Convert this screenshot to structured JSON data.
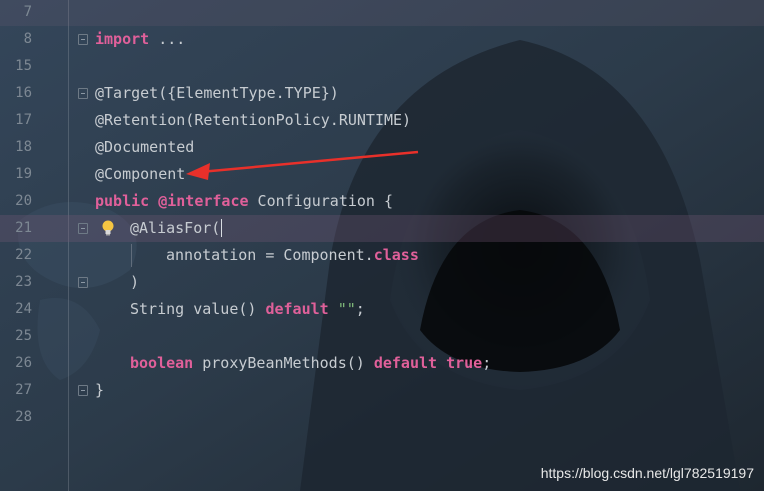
{
  "editor": {
    "lines": [
      {
        "num": "7",
        "tokens": []
      },
      {
        "num": "8",
        "tokens": [
          {
            "t": "import",
            "c": "kw"
          },
          {
            "t": " ...",
            "c": "plain"
          }
        ]
      },
      {
        "num": "15",
        "tokens": []
      },
      {
        "num": "16",
        "tokens": [
          {
            "t": "@Target({ElementType.TYPE})",
            "c": "plain"
          }
        ]
      },
      {
        "num": "17",
        "tokens": [
          {
            "t": "@Retention(RetentionPolicy.RUNTIME)",
            "c": "plain"
          }
        ]
      },
      {
        "num": "18",
        "tokens": [
          {
            "t": "@Documented",
            "c": "plain"
          }
        ]
      },
      {
        "num": "19",
        "tokens": [
          {
            "t": "@Component",
            "c": "plain"
          }
        ]
      },
      {
        "num": "20",
        "tokens": [
          {
            "t": "public",
            "c": "kw"
          },
          {
            "t": " ",
            "c": "plain"
          },
          {
            "t": "@interface",
            "c": "kw"
          },
          {
            "t": " Configuration {",
            "c": "plain"
          }
        ]
      },
      {
        "num": "21",
        "tokens": [
          {
            "t": "@AliasFor(",
            "c": "plain"
          }
        ]
      },
      {
        "num": "22",
        "tokens": [
          {
            "t": "annotation = Component.",
            "c": "plain"
          },
          {
            "t": "class",
            "c": "kw"
          }
        ]
      },
      {
        "num": "23",
        "tokens": [
          {
            "t": ")",
            "c": "plain"
          }
        ]
      },
      {
        "num": "24",
        "tokens": [
          {
            "t": "String value() ",
            "c": "plain"
          },
          {
            "t": "default",
            "c": "kw"
          },
          {
            "t": " ",
            "c": "plain"
          },
          {
            "t": "\"\"",
            "c": "str"
          },
          {
            "t": ";",
            "c": "plain"
          }
        ]
      },
      {
        "num": "25",
        "tokens": []
      },
      {
        "num": "26",
        "tokens": [
          {
            "t": "boolean",
            "c": "kw"
          },
          {
            "t": " proxyBeanMethods() ",
            "c": "plain"
          },
          {
            "t": "default",
            "c": "kw"
          },
          {
            "t": " ",
            "c": "plain"
          },
          {
            "t": "true",
            "c": "kw"
          },
          {
            "t": ";",
            "c": "plain"
          }
        ]
      },
      {
        "num": "27",
        "tokens": [
          {
            "t": "}",
            "c": "plain"
          }
        ]
      },
      {
        "num": "28",
        "tokens": []
      }
    ]
  },
  "watermark": "https://blog.csdn.net/lgl782519197",
  "colors": {
    "keyword": "#e0609a",
    "text": "#c7ccd1",
    "line_number": "#7d8893",
    "arrow": "#e8302a"
  },
  "icons": {
    "bulb": "lightbulb-icon",
    "fold": "fold-icon"
  }
}
